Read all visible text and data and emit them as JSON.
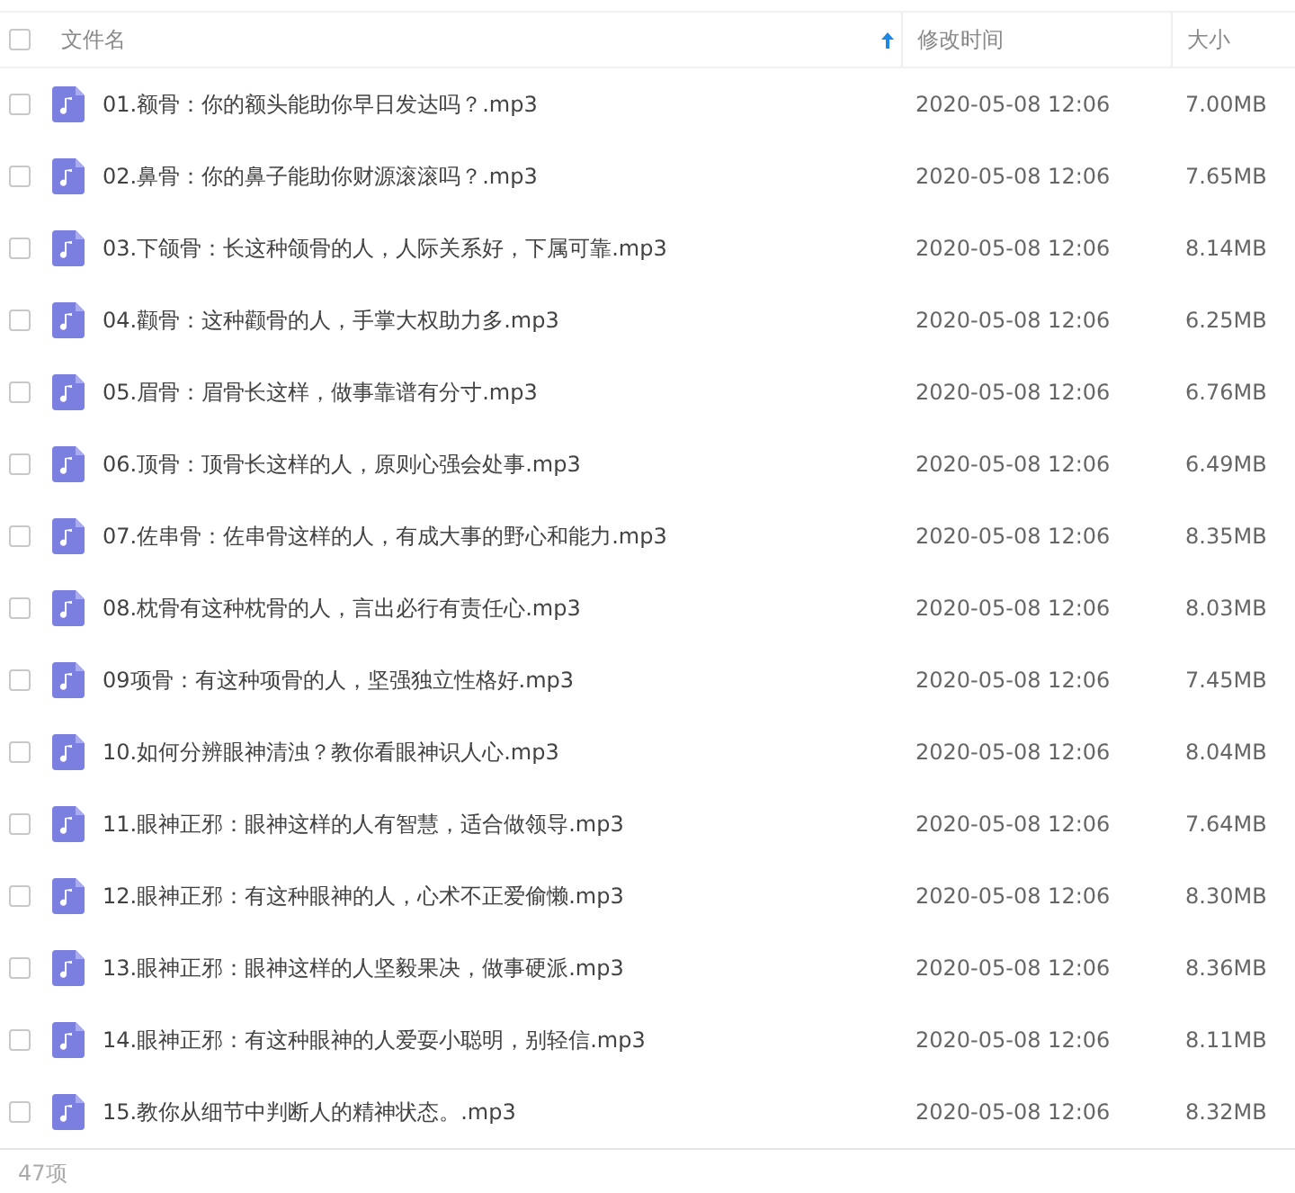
{
  "header": {
    "checked": false,
    "columns": [
      {
        "label": "文件名",
        "sorted": true
      },
      {
        "label": "修改时间",
        "sorted": false
      },
      {
        "label": "大小",
        "sorted": false
      }
    ]
  },
  "files": [
    {
      "name": "01.额骨：你的额头能助你早日发达吗？.mp3",
      "modified": "2020-05-08 12:06",
      "size": "7.00MB",
      "checked": false
    },
    {
      "name": "02.鼻骨：你的鼻子能助你财源滚滚吗？.mp3",
      "modified": "2020-05-08 12:06",
      "size": "7.65MB",
      "checked": false
    },
    {
      "name": "03.下颌骨：长这种颌骨的人，人际关系好，下属可靠.mp3",
      "modified": "2020-05-08 12:06",
      "size": "8.14MB",
      "checked": false
    },
    {
      "name": "04.颧骨：这种颧骨的人，手掌大权助力多.mp3",
      "modified": "2020-05-08 12:06",
      "size": "6.25MB",
      "checked": false
    },
    {
      "name": "05.眉骨：眉骨长这样，做事靠谱有分寸.mp3",
      "modified": "2020-05-08 12:06",
      "size": "6.76MB",
      "checked": false
    },
    {
      "name": "06.顶骨：顶骨长这样的人，原则心强会处事.mp3",
      "modified": "2020-05-08 12:06",
      "size": "6.49MB",
      "checked": false
    },
    {
      "name": "07.佐串骨：佐串骨这样的人，有成大事的野心和能力.mp3",
      "modified": "2020-05-08 12:06",
      "size": "8.35MB",
      "checked": false
    },
    {
      "name": "08.枕骨有这种枕骨的人，言出必行有责任心.mp3",
      "modified": "2020-05-08 12:06",
      "size": "8.03MB",
      "checked": false
    },
    {
      "name": "09项骨：有这种项骨的人，坚强独立性格好.mp3",
      "modified": "2020-05-08 12:06",
      "size": "7.45MB",
      "checked": false
    },
    {
      "name": "10.如何分辨眼神清浊？教你看眼神识人心.mp3",
      "modified": "2020-05-08 12:06",
      "size": "8.04MB",
      "checked": false
    },
    {
      "name": "11.眼神正邪：眼神这样的人有智慧，适合做领导.mp3",
      "modified": "2020-05-08 12:06",
      "size": "7.64MB",
      "checked": false
    },
    {
      "name": "12.眼神正邪：有这种眼神的人，心术不正爱偷懒.mp3",
      "modified": "2020-05-08 12:06",
      "size": "8.30MB",
      "checked": false
    },
    {
      "name": "13.眼神正邪：眼神这样的人坚毅果决，做事硬派.mp3",
      "modified": "2020-05-08 12:06",
      "size": "8.36MB",
      "checked": false
    },
    {
      "name": "14.眼神正邪：有这种眼神的人爱耍小聪明，别轻信.mp3",
      "modified": "2020-05-08 12:06",
      "size": "8.11MB",
      "checked": false
    },
    {
      "name": "15.教你从细节中判断人的精神状态。.mp3",
      "modified": "2020-05-08 12:06",
      "size": "8.32MB",
      "checked": false
    }
  ],
  "footer": {
    "count": "47项"
  }
}
